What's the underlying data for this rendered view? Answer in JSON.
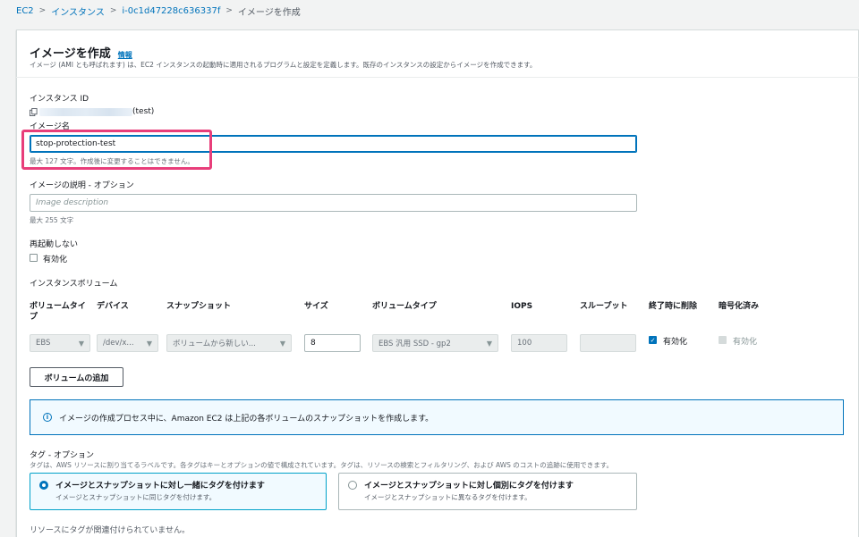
{
  "breadcrumb": {
    "items": [
      "EC2",
      "インスタンス",
      "i-0c1d47228c636337f"
    ],
    "current": "イメージを作成"
  },
  "header": {
    "title": "イメージを作成",
    "info_link": "情報",
    "description": "イメージ (AMI とも呼ばれます) は、EC2 インスタンスの起動時に適用されるプログラムと設定を定義します。既存のインスタンスの設定からイメージを作成できます。"
  },
  "instance_id": {
    "label": "インスタンス ID",
    "suffix": "(test)"
  },
  "image_name": {
    "label": "イメージ名",
    "value": "stop-protection-test",
    "hint": "最大 127 文字。作成後に変更することはできません。"
  },
  "image_description": {
    "label": "イメージの説明 - オプション",
    "placeholder": "Image description",
    "hint": "最大 255 文字"
  },
  "no_reboot": {
    "label": "再起動しない",
    "checkbox_label": "有効化"
  },
  "volumes": {
    "section_label": "インスタンスボリューム",
    "columns": [
      "ボリュームタイプ",
      "デバイス",
      "スナップショット",
      "サイズ",
      "ボリュームタイプ",
      "IOPS",
      "スループット",
      "終了時に削除",
      "暗号化済み"
    ],
    "row": {
      "volume_type": "EBS",
      "device": "/dev/x...",
      "snapshot": "ボリュームから新しい...",
      "size": "8",
      "ebs_type": "EBS 汎用 SSD - gp2",
      "iops": "100",
      "throughput": "",
      "delete_on_termination": "有効化",
      "encrypted": "有効化"
    },
    "add_button": "ボリュームの追加"
  },
  "alert": {
    "text": "イメージの作成プロセス中に、Amazon EC2 は上記の各ボリュームのスナップショットを作成します。"
  },
  "tags": {
    "label": "タグ - オプション",
    "description": "タグは、AWS リソースに割り当てるラベルです。各タグはキーとオプションの値で構成されています。タグは、リソースの検索とフィルタリング、および AWS のコストの追跡に使用できます。",
    "option1_title": "イメージとスナップショットに対し一緒にタグを付けます",
    "option1_desc": "イメージとスナップショットに同じタグを付けます。",
    "option2_title": "イメージとスナップショットに対し個別にタグを付けます",
    "option2_desc": "イメージとスナップショットに異なるタグを付けます。",
    "empty": "リソースにタグが関連付けられていません。"
  },
  "colors": {
    "accent": "#0073bb",
    "highlight": "#e83e7a"
  }
}
